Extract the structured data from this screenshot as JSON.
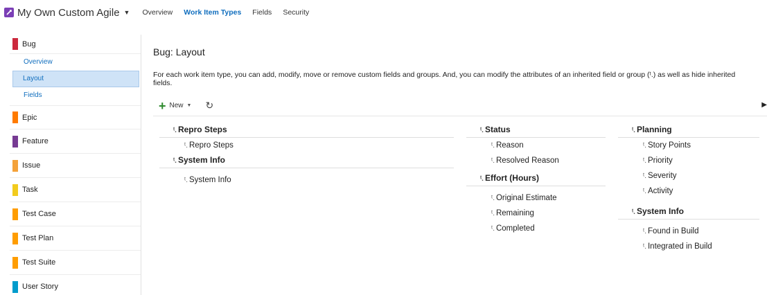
{
  "header": {
    "project_name": "My Own Custom Agile",
    "nav": [
      "Overview",
      "Work Item Types",
      "Fields",
      "Security"
    ],
    "active_nav": "Work Item Types",
    "colors": {
      "project_icon": "#7b3fb6",
      "link": "#106ebe"
    }
  },
  "sidebar": {
    "items": [
      {
        "label": "Bug",
        "color": "#cc293d"
      },
      {
        "label": "Epic",
        "color": "#ff7b00"
      },
      {
        "label": "Feature",
        "color": "#773b93"
      },
      {
        "label": "Issue",
        "color": "#f4a23a"
      },
      {
        "label": "Task",
        "color": "#f2cb1d"
      },
      {
        "label": "Test Case",
        "color": "#ff9d00"
      },
      {
        "label": "Test Plan",
        "color": "#ff9d00"
      },
      {
        "label": "Test Suite",
        "color": "#ff9d00"
      },
      {
        "label": "User Story",
        "color": "#009ccc"
      }
    ],
    "bug_subitems": [
      "Overview",
      "Layout",
      "Fields"
    ],
    "selected_subitem": "Layout"
  },
  "main": {
    "title": "Bug: Layout",
    "description_1": "For each work item type, you can add, modify, move or remove custom fields and groups. And, you can modify the attributes of an inherited field or group (",
    "inherited_symbol": "ᵗ.",
    "description_2": ") as well as hide inherited fields.",
    "toolbar": {
      "new_label": "New",
      "refresh_icon": "refresh-icon"
    },
    "columns": [
      {
        "groups": [
          {
            "title": "Repro Steps",
            "fields": [
              "Repro Steps"
            ]
          },
          {
            "title": "System Info",
            "fields": [
              "System Info"
            ]
          }
        ]
      },
      {
        "groups": [
          {
            "title": "Status",
            "fields": [
              "Reason",
              "Resolved Reason"
            ]
          },
          {
            "title": "Effort (Hours)",
            "fields": [
              "Original Estimate",
              "Remaining",
              "Completed"
            ]
          }
        ]
      },
      {
        "groups": [
          {
            "title": "Planning",
            "fields": [
              "Story Points",
              "Priority",
              "Severity",
              "Activity"
            ]
          },
          {
            "title": "System Info",
            "fields": [
              "Found in Build",
              "Integrated in Build"
            ]
          }
        ]
      }
    ]
  }
}
